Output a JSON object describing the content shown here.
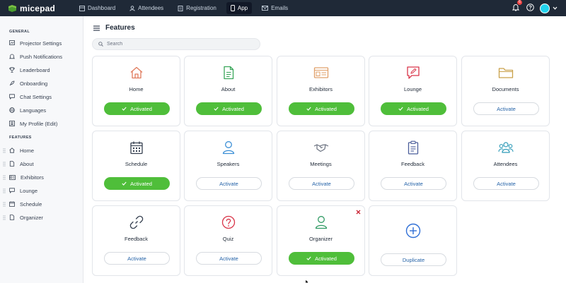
{
  "app": {
    "brand": "micepad"
  },
  "nav": [
    {
      "label": "Dashboard",
      "icon": "dashboard-icon"
    },
    {
      "label": "Attendees",
      "icon": "user-icon"
    },
    {
      "label": "Registration",
      "icon": "document-icon"
    },
    {
      "label": "App",
      "icon": "mobile-icon",
      "active": true
    },
    {
      "label": "Emails",
      "icon": "mail-icon"
    }
  ],
  "topright": {
    "notification_count": "6"
  },
  "sidebar": {
    "general_label": "GENERAL",
    "general": [
      {
        "label": "Projector Settings",
        "icon": "projector-icon"
      },
      {
        "label": "Push Notifications",
        "icon": "bell-icon"
      },
      {
        "label": "Leaderboard",
        "icon": "trophy-icon"
      },
      {
        "label": "Onboarding",
        "icon": "rocket-icon"
      },
      {
        "label": "Chat Settings",
        "icon": "chat-icon"
      },
      {
        "label": "Languages",
        "icon": "globe-icon"
      },
      {
        "label": "My Profile (Edit)",
        "icon": "profile-icon"
      }
    ],
    "features_label": "FEATURES",
    "features": [
      {
        "label": "Home",
        "icon": "home-icon"
      },
      {
        "label": "About",
        "icon": "document-icon"
      },
      {
        "label": "Exhibitors",
        "icon": "id-card-icon"
      },
      {
        "label": "Lounge",
        "icon": "chat-icon"
      },
      {
        "label": "Schedule",
        "icon": "calendar-icon"
      },
      {
        "label": "Organizer",
        "icon": "document-icon"
      }
    ]
  },
  "page": {
    "title": "Features",
    "search_placeholder": "Search"
  },
  "cards": [
    {
      "title": "Home",
      "button": "Activated",
      "state": "on",
      "icon": "home-icon",
      "color": "#e07b5d"
    },
    {
      "title": "About",
      "button": "Activated",
      "state": "on",
      "icon": "document-icon",
      "color": "#3aa65a"
    },
    {
      "title": "Exhibitors",
      "button": "Activated",
      "state": "on",
      "icon": "id-card-icon",
      "color": "#e0a06a"
    },
    {
      "title": "Lounge",
      "button": "Activated",
      "state": "on",
      "icon": "chat-pen-icon",
      "color": "#d9364a"
    },
    {
      "title": "Documents",
      "button": "Activate",
      "state": "off",
      "icon": "folder-icon",
      "color": "#c9a14a"
    },
    {
      "title": "Schedule",
      "button": "Activated",
      "state": "on",
      "icon": "calendar-icon",
      "color": "#374151"
    },
    {
      "title": "Speakers",
      "button": "Activate",
      "state": "off",
      "icon": "user-icon",
      "color": "#3b8fd6"
    },
    {
      "title": "Meetings",
      "button": "Activate",
      "state": "off",
      "icon": "handshake-icon",
      "color": "#6b7280"
    },
    {
      "title": "Feedback",
      "button": "Activate",
      "state": "off",
      "icon": "clipboard-icon",
      "color": "#4b5e9a"
    },
    {
      "title": "Attendees",
      "button": "Activate",
      "state": "off",
      "icon": "group-icon",
      "color": "#2f9bb8"
    },
    {
      "title": "Feedback",
      "button": "Activate",
      "state": "off",
      "icon": "link-icon",
      "color": "#374151"
    },
    {
      "title": "Quiz",
      "button": "Activate",
      "state": "off",
      "icon": "question-icon",
      "color": "#d9364a"
    },
    {
      "title": "Organizer",
      "button": "Activated",
      "state": "on",
      "icon": "user-icon",
      "color": "#2f9a63",
      "removable": true
    },
    {
      "title": "",
      "button": "Duplicate",
      "state": "off",
      "icon": "plus-circle-icon",
      "color": "#2f6fd6"
    }
  ]
}
